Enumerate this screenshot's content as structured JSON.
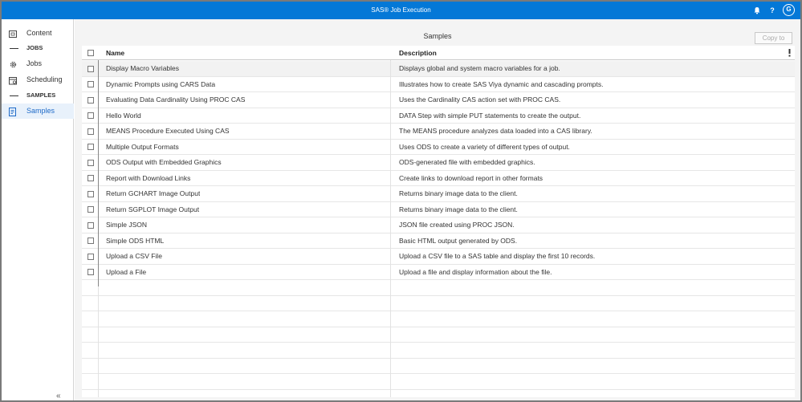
{
  "header": {
    "title": "SAS® Job Execution",
    "help_label": "?",
    "avatar_initial": "G"
  },
  "sidebar": {
    "items": [
      {
        "type": "item",
        "label": "Content",
        "icon": "content-icon"
      },
      {
        "type": "section",
        "label": "JOBS"
      },
      {
        "type": "item",
        "label": "Jobs",
        "icon": "gear-icon"
      },
      {
        "type": "item",
        "label": "Scheduling",
        "icon": "calendar-icon"
      },
      {
        "type": "section",
        "label": "SAMPLES"
      },
      {
        "type": "item",
        "label": "Samples",
        "icon": "samples-icon",
        "selected": true
      }
    ],
    "collapse_label": "«"
  },
  "main": {
    "title": "Samples",
    "copy_button": "Copy to",
    "columns": {
      "name": "Name",
      "description": "Description"
    },
    "rows": [
      {
        "name": "Display Macro Variables",
        "description": "Displays global and system macro variables for a job."
      },
      {
        "name": "Dynamic Prompts using CARS Data",
        "description": "Illustrates how to create SAS Viya dynamic and cascading prompts."
      },
      {
        "name": "Evaluating Data Cardinality Using PROC CAS",
        "description": "Uses the Cardinality CAS action set with PROC CAS."
      },
      {
        "name": "Hello World",
        "description": "DATA Step with simple PUT statements to create the output."
      },
      {
        "name": "MEANS Procedure Executed Using CAS",
        "description": "The MEANS procedure analyzes data loaded into a CAS library."
      },
      {
        "name": "Multiple Output Formats",
        "description": "Uses ODS to create a variety of different types of output."
      },
      {
        "name": "ODS Output with Embedded Graphics",
        "description": "ODS-generated file with embedded graphics."
      },
      {
        "name": "Report with Download Links",
        "description": "Create links to download report in other formats"
      },
      {
        "name": "Return GCHART Image Output",
        "description": "Returns binary image data to the client."
      },
      {
        "name": "Return SGPLOT Image Output",
        "description": "Returns binary image data to the client."
      },
      {
        "name": "Simple JSON",
        "description": "JSON file created using PROC JSON."
      },
      {
        "name": "Simple ODS HTML",
        "description": "Basic HTML output generated by ODS."
      },
      {
        "name": "Upload a CSV File",
        "description": "Upload a CSV file to a SAS table and display the first 10 records."
      },
      {
        "name": "Upload a File",
        "description": "Upload a file and display information about the file."
      }
    ]
  },
  "colors": {
    "header_bg": "#0478d7",
    "selected_nav_text": "#1e6ac8"
  }
}
